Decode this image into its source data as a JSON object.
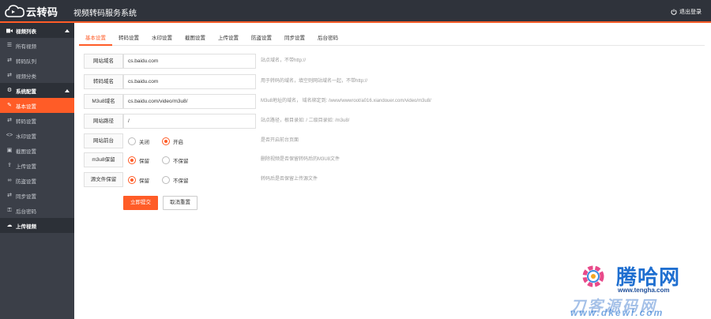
{
  "header": {
    "logo_text": "云转码",
    "system_title": "视频转码服务系统",
    "logout_label": "退出登录"
  },
  "sidebar": {
    "groups": [
      {
        "label": "视频列表",
        "items": [
          "所有视频",
          "转码队列",
          "视频分类"
        ]
      },
      {
        "label": "系统配置",
        "items": [
          "基本设置",
          "转码设置",
          "水印设置",
          "截图设置",
          "上传设置",
          "防盗设置",
          "同步设置",
          "后台密码"
        ]
      }
    ],
    "extra_item": "上传视频",
    "active_item": "基本设置"
  },
  "tabs": [
    "基本设置",
    "转码设置",
    "水印设置",
    "截图设置",
    "上传设置",
    "防盗设置",
    "同步设置",
    "后台密码"
  ],
  "form": {
    "site_domain": {
      "label": "网站域名",
      "value": "cs.baidu.com",
      "hint": "站点域名，不带http://"
    },
    "transcode_domain": {
      "label": "转码域名",
      "value": "cs.baidu.com",
      "hint": "用于转码的域名，填空则网站域名一起，不带http://"
    },
    "m3u8_domain": {
      "label": "M3u8域名",
      "value": "cs.baidu.com/video/m3u8/",
      "hint": "M3u8地址的域名，  域名绑定到: /www/wwwroot/a016.xiandouer.com/video/m3u8/"
    },
    "site_path": {
      "label": "网站路径",
      "value": "/",
      "hint": "站点路径，根目录如: / 二级目录如: /m3u8/"
    },
    "frontend": {
      "label": "网站前台",
      "options": [
        "关闭",
        "开启"
      ],
      "selected": 1,
      "hint": "是否开启前台页面"
    },
    "m3u8_keep": {
      "label": "m3u8保留",
      "options": [
        "保留",
        "不保留"
      ],
      "selected": 0,
      "hint": "删除视频是否保留转码后的M3U8文件"
    },
    "source_keep": {
      "label": "源文件保留",
      "options": [
        "保留",
        "不保留"
      ],
      "selected": 0,
      "hint": "转码后是否保留上传源文件"
    },
    "submit_label": "立即提交",
    "reset_label": "取消重置"
  },
  "watermark": {
    "title": "腾哈网",
    "url1": "www.tengha.com",
    "cn": "刀客源码网",
    "url2": "www.dkewl.com"
  },
  "colors": {
    "accent": "#ff5c27",
    "header_bg": "#2f333b",
    "sidebar_bg": "#3b3f48"
  }
}
